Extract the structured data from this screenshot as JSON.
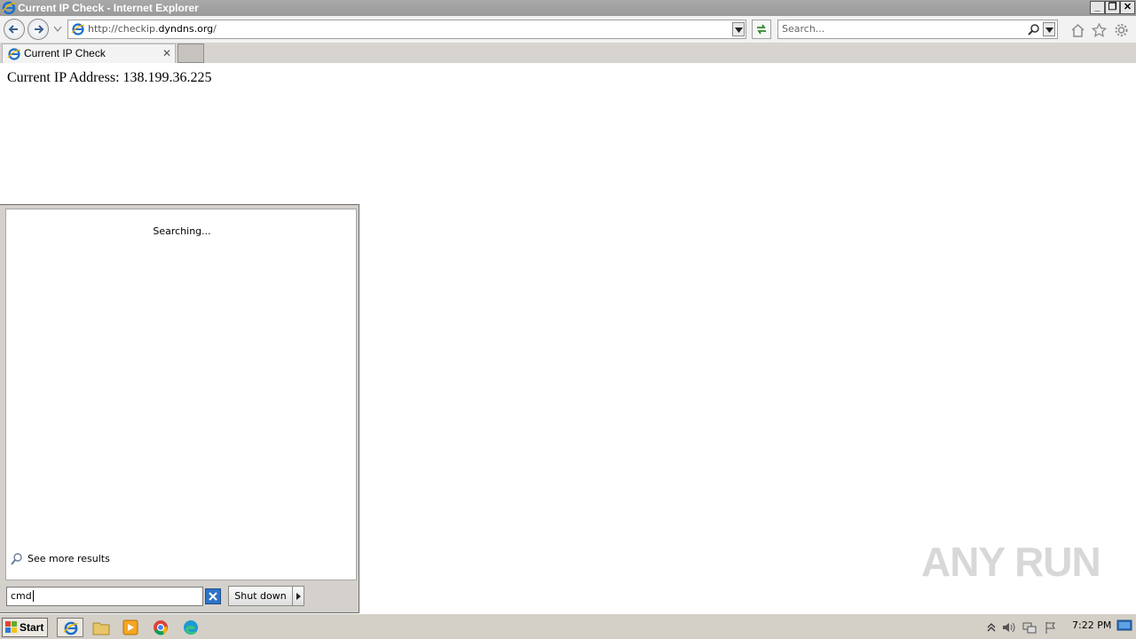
{
  "window": {
    "title": "Current IP Check - Internet Explorer",
    "buttons": {
      "minimize": "_",
      "restore": "❐",
      "close": "✕"
    }
  },
  "navbar": {
    "url_prefix": "http://checkip.",
    "url_domain": "dyndns.org",
    "url_suffix": "/",
    "search_placeholder": "Search..."
  },
  "tabs": [
    {
      "label": "Current IP Check",
      "close": "✕"
    }
  ],
  "page": {
    "ip_text": "Current IP Address: 138.199.36.225"
  },
  "start_menu": {
    "status": "Searching...",
    "see_more": "See more results",
    "search_value": "cmd",
    "shutdown_label": "Shut down"
  },
  "watermark": {
    "text": "ANY RUN"
  },
  "taskbar": {
    "start_label": "Start",
    "clock": "7:22 PM"
  },
  "colors": {
    "title_bar": "#9e9e9e",
    "ie_blue": "#1e6fc8",
    "taskbar": "#d4d0c8",
    "start_menu": "#d4d0cb"
  },
  "icons": {
    "browser": "ie-icon",
    "back": "back-arrow-icon",
    "forward": "forward-arrow-icon",
    "refresh": "refresh-icon",
    "search": "search-icon",
    "home": "home-icon",
    "favorites": "star-icon",
    "tools": "gear-icon",
    "explorer": "folder-icon",
    "media": "media-player-icon",
    "chrome": "chrome-icon",
    "edge": "edge-icon"
  }
}
